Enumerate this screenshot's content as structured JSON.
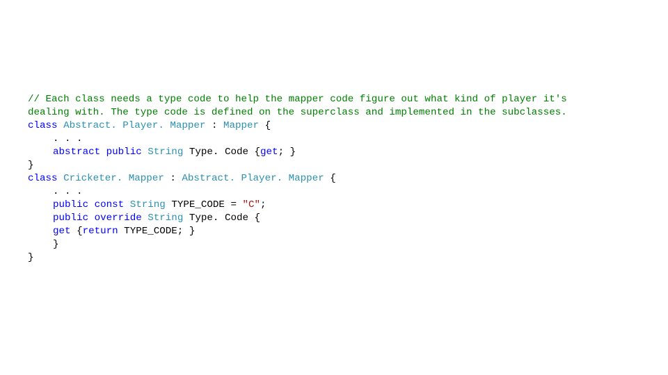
{
  "code": {
    "comment1": "// Each class needs a type code to help the mapper code figure out what kind of player it's",
    "comment2": "dealing with. The type code is defined on the superclass and implemented in the subclasses.",
    "l3": {
      "kw_class": "class",
      "type1": "Abstract. Player. Mapper ",
      "colon": ": ",
      "type2": "Mapper ",
      "brace": "{"
    },
    "l4": {
      "dots": ". . ."
    },
    "l5": {
      "kw_abstract": "abstract",
      "kw_public": "public",
      "type": "String ",
      "member": "Type. Code ",
      "brace_open": "{",
      "kw_get": "get",
      "semi_brace": "; }"
    },
    "l6": {
      "brace": "}"
    },
    "l7": {
      "kw_class": "class",
      "type1": "Cricketer. Mapper ",
      "colon": ": ",
      "type2": "Abstract. Player. Mapper ",
      "brace": "{"
    },
    "l8": {
      "dots": ". . ."
    },
    "l9": {
      "kw_public": "public",
      "kw_const": "const",
      "type": "String ",
      "name": "TYPE_CODE = ",
      "str": "\"C\"",
      "semi": ";"
    },
    "l10": {
      "kw_public": "public",
      "kw_override": "override",
      "type": "String ",
      "member": "Type. Code ",
      "brace": "{"
    },
    "l11": {
      "kw_get": "get",
      "brace_open": "{",
      "kw_return": "return",
      "name": " TYPE_CODE; }"
    },
    "l12": {
      "brace": "}"
    },
    "l13": {
      "brace": "}"
    }
  }
}
